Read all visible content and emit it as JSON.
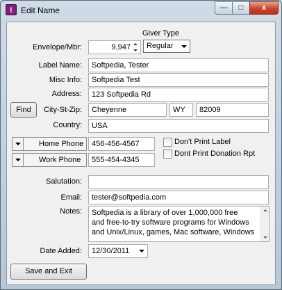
{
  "window": {
    "title": "Edit Name",
    "app_icon": "ticket-icon",
    "controls": {
      "minimize": "—",
      "maximize": "□",
      "close": "x"
    }
  },
  "form": {
    "giver_type": {
      "label": "Giver Type",
      "value": "Regular"
    },
    "envelope": {
      "label": "Envelope/Mbr:",
      "value": "9,947"
    },
    "label_name": {
      "label": "Label Name:",
      "value": "Softpedia, Tester"
    },
    "misc_info": {
      "label": "Misc Info:",
      "value": "Softpedia Test"
    },
    "address": {
      "label": "Address:",
      "value": "123 Softpedia Rd"
    },
    "find_button": "Find",
    "city_st_zip": {
      "label": "City-St-Zip:",
      "city": "Cheyenne",
      "state": "WY",
      "zip": "82009"
    },
    "country": {
      "label": "Country:",
      "value": "USA"
    },
    "home_phone": {
      "label": "Home Phone",
      "value": "456-456-4567"
    },
    "work_phone": {
      "label": "Work Phone",
      "value": "555-454-4345"
    },
    "dont_print_label": {
      "label": "Don't Print Label",
      "checked": false
    },
    "dont_print_donation": {
      "label": "Dont Print Donation Rpt",
      "checked": false
    },
    "salutation": {
      "label": "Salutation:",
      "value": ""
    },
    "email": {
      "label": "Email:",
      "value": "tester@softpedia.com"
    },
    "notes": {
      "label": "Notes:",
      "lines": [
        "Softpedia is a library of over 1,000,000 free",
        "and free-to-try software programs for Windows",
        "and Unix/Linux, games, Mac software, Windows"
      ]
    },
    "date_added": {
      "label": "Date Added:",
      "value": "12/30/2011"
    },
    "save_button": "Save and Exit"
  }
}
